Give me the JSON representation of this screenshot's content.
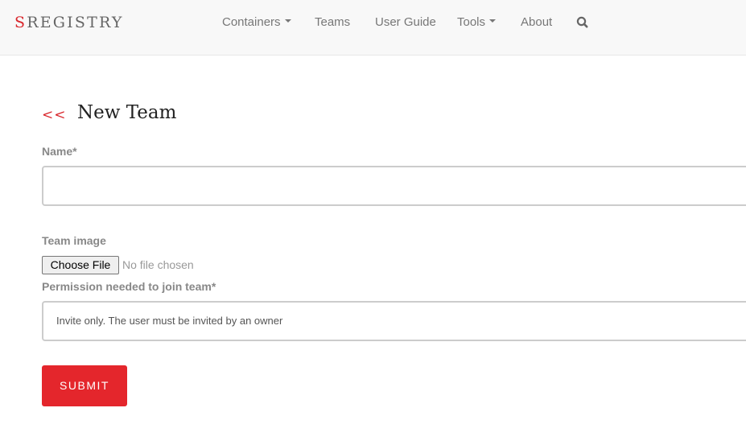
{
  "navbar": {
    "brand_first": "S",
    "brand_rest": "REGISTRY",
    "items": [
      {
        "label": "Containers",
        "dropdown": true
      },
      {
        "label": "Teams",
        "dropdown": false
      },
      {
        "label": "User Guide",
        "dropdown": false
      },
      {
        "label": "Tools",
        "dropdown": true
      },
      {
        "label": "About",
        "dropdown": false
      }
    ],
    "search_icon": "search-icon"
  },
  "page": {
    "back_link": "<<",
    "title": "New Team"
  },
  "form": {
    "name_label": "Name*",
    "name_value": "",
    "image_label": "Team image",
    "choose_file_label": "Choose File",
    "file_status": "No file chosen",
    "permission_label": "Permission needed to join team*",
    "permission_selected": "Invite only. The user must be invited by an owner",
    "submit_label": "SUBMIT"
  },
  "colors": {
    "accent": "#e4262c",
    "navbar_bg": "#f8f8f8",
    "nav_text": "#777777",
    "label_text": "#888888"
  }
}
